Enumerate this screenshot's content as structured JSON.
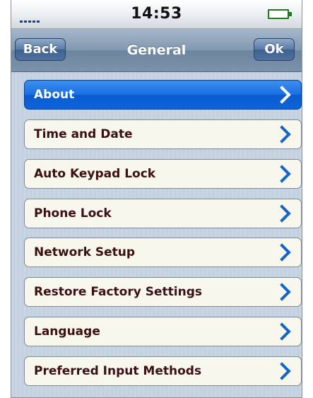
{
  "status_bar": {
    "time": "14:53",
    "signal_icon": "signal-strength-icon",
    "battery_icon": "battery-icon"
  },
  "nav": {
    "back_label": "Back",
    "title": "General",
    "ok_label": "Ok"
  },
  "menu": {
    "items": [
      {
        "label": "About",
        "selected": true
      },
      {
        "label": "Time and Date",
        "selected": false
      },
      {
        "label": "Auto Keypad Lock",
        "selected": false
      },
      {
        "label": "Phone Lock",
        "selected": false
      },
      {
        "label": "Network Setup",
        "selected": false
      },
      {
        "label": "Restore Factory Settings",
        "selected": false
      },
      {
        "label": "Language",
        "selected": false
      },
      {
        "label": "Preferred Input Methods",
        "selected": false
      }
    ]
  },
  "colors": {
    "selection_blue": "#1665c8",
    "item_text": "#3a1010",
    "battery_green": "#1f7a1f"
  }
}
